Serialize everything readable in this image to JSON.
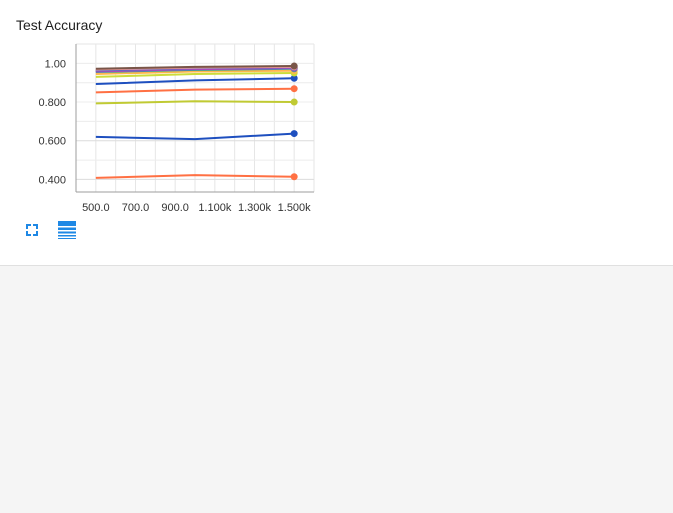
{
  "card": {
    "title": "Test Accuracy"
  },
  "toolbar": {
    "fullscreen_icon": "fullscreen-icon",
    "data_table_icon": "data-table-icon",
    "accent_color": "#1e88e5"
  },
  "chart_data": {
    "type": "line",
    "title": "",
    "xlabel": "",
    "ylabel": "",
    "xlim": [
      400,
      1600
    ],
    "ylim": [
      0.335,
      1.1
    ],
    "x_ticks": [
      500,
      700,
      900,
      1100,
      1300,
      1500
    ],
    "x_tick_labels": [
      "500.0",
      "700.0",
      "900.0",
      "1.100k",
      "1.300k",
      "1.500k"
    ],
    "y_ticks": [
      0.4,
      0.6,
      0.8,
      1.0
    ],
    "y_tick_labels": [
      "0.400",
      "0.600",
      "0.800",
      "1.00"
    ],
    "grid": true,
    "series": [
      {
        "color": "#ff7043",
        "x": [
          500,
          1000,
          1500
        ],
        "y": [
          0.408,
          0.422,
          0.414
        ]
      },
      {
        "color": "#1e4fbf",
        "x": [
          500,
          1000,
          1500
        ],
        "y": [
          0.62,
          0.608,
          0.637
        ]
      },
      {
        "color": "#c0ca33",
        "x": [
          500,
          1000,
          1500
        ],
        "y": [
          0.793,
          0.804,
          0.8
        ]
      },
      {
        "color": "#ff7043",
        "x": [
          500,
          1000,
          1500
        ],
        "y": [
          0.85,
          0.864,
          0.869
        ]
      },
      {
        "color": "#1e4fbf",
        "x": [
          500,
          1000,
          1500
        ],
        "y": [
          0.893,
          0.912,
          0.923
        ]
      },
      {
        "color": "#cddc39",
        "x": [
          500,
          1000,
          1500
        ],
        "y": [
          0.93,
          0.945,
          0.95
        ]
      },
      {
        "color": "#ffb74d",
        "x": [
          500,
          1000,
          1500
        ],
        "y": [
          0.945,
          0.958,
          0.962
        ]
      },
      {
        "color": "#26a69a",
        "x": [
          500,
          1000,
          1500
        ],
        "y": [
          0.955,
          0.966,
          0.972
        ]
      },
      {
        "color": "#8d6e63",
        "x": [
          500,
          1000,
          1500
        ],
        "y": [
          0.962,
          0.972,
          0.976
        ]
      },
      {
        "color": "#ab47bc",
        "x": [
          500,
          1000,
          1500
        ],
        "y": [
          0.958,
          0.97,
          0.975
        ]
      },
      {
        "color": "#5c6bc0",
        "x": [
          500,
          1000,
          1500
        ],
        "y": [
          0.963,
          0.975,
          0.98
        ]
      },
      {
        "color": "#ef9a9a",
        "x": [
          500,
          1000,
          1500
        ],
        "y": [
          0.968,
          0.978,
          0.982
        ]
      },
      {
        "color": "#795548",
        "x": [
          500,
          1000,
          1500
        ],
        "y": [
          0.972,
          0.982,
          0.986
        ]
      }
    ]
  }
}
